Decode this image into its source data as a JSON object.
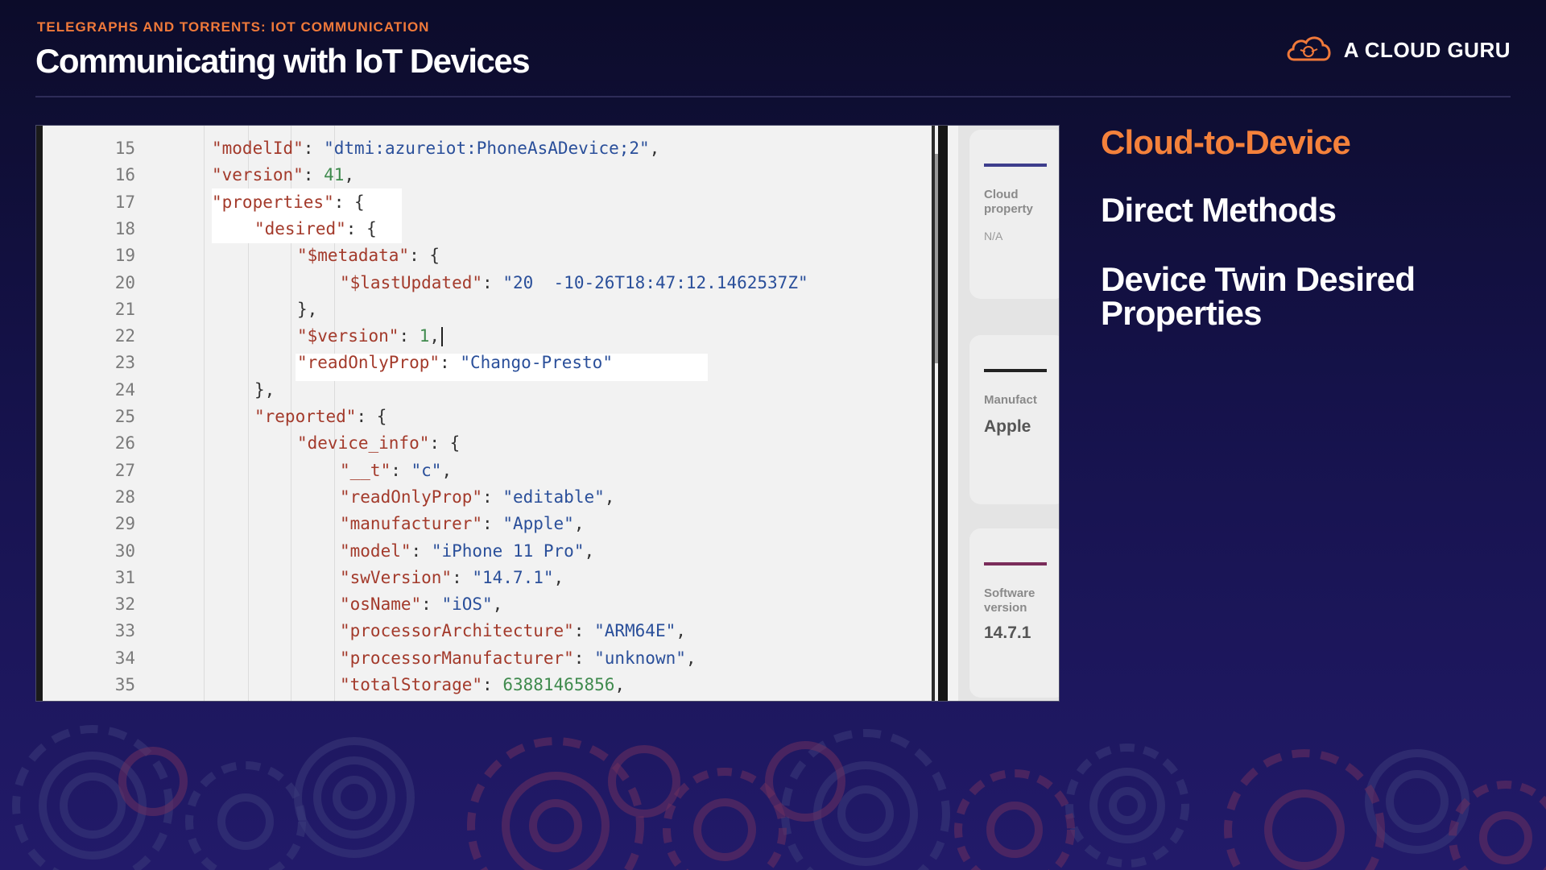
{
  "header": {
    "eyebrow": "TELEGRAPHS AND TORRENTS: IOT COMMUNICATION",
    "title": "Communicating with IoT Devices",
    "brand": "A CLOUD GURU",
    "brand_icon": "cloud-logo-icon"
  },
  "code": {
    "lines": [
      {
        "n": "15",
        "indent": 0,
        "key": "\"modelId\"",
        "sep": ": ",
        "val": "\"dtmi:azureiot:PhoneAsADevice;2\"",
        "vtype": "s",
        "tail": ","
      },
      {
        "n": "16",
        "indent": 0,
        "key": "\"version\"",
        "sep": ": ",
        "val": "41",
        "vtype": "n",
        "tail": ","
      },
      {
        "n": "17",
        "indent": 0,
        "key": "\"properties\"",
        "sep": ": ",
        "val": "",
        "vtype": "p",
        "tail": "{"
      },
      {
        "n": "18",
        "indent": 1,
        "key": "\"desired\"",
        "sep": ": ",
        "val": "",
        "vtype": "p",
        "tail": "{"
      },
      {
        "n": "19",
        "indent": 2,
        "key": "\"$metadata\"",
        "sep": ": ",
        "val": "",
        "vtype": "p",
        "tail": "{"
      },
      {
        "n": "20",
        "indent": 3,
        "key": "\"$lastUpdated\"",
        "sep": ": ",
        "val": "\"20  -10-26T18:47:12.1462537Z\"",
        "vtype": "s",
        "tail": ""
      },
      {
        "n": "21",
        "indent": 2,
        "key": "",
        "sep": "",
        "val": "",
        "vtype": "p",
        "tail": "},"
      },
      {
        "n": "22",
        "indent": 2,
        "key": "\"$version\"",
        "sep": ": ",
        "val": "1",
        "vtype": "n",
        "tail": ","
      },
      {
        "n": "23",
        "indent": 2,
        "key": "\"readOnlyProp\"",
        "sep": ": ",
        "val": "\"Chango-Presto\"",
        "vtype": "s",
        "tail": ""
      },
      {
        "n": "24",
        "indent": 1,
        "key": "",
        "sep": "",
        "val": "",
        "vtype": "p",
        "tail": "},"
      },
      {
        "n": "25",
        "indent": 1,
        "key": "\"reported\"",
        "sep": ": ",
        "val": "",
        "vtype": "p",
        "tail": "{"
      },
      {
        "n": "26",
        "indent": 2,
        "key": "\"device_info\"",
        "sep": ": ",
        "val": "",
        "vtype": "p",
        "tail": "{"
      },
      {
        "n": "27",
        "indent": 3,
        "key": "\"__t\"",
        "sep": ": ",
        "val": "\"c\"",
        "vtype": "s",
        "tail": ","
      },
      {
        "n": "28",
        "indent": 3,
        "key": "\"readOnlyProp\"",
        "sep": ": ",
        "val": "\"editable\"",
        "vtype": "s",
        "tail": ","
      },
      {
        "n": "29",
        "indent": 3,
        "key": "\"manufacturer\"",
        "sep": ": ",
        "val": "\"Apple\"",
        "vtype": "s",
        "tail": ","
      },
      {
        "n": "30",
        "indent": 3,
        "key": "\"model\"",
        "sep": ": ",
        "val": "\"iPhone 11 Pro\"",
        "vtype": "s",
        "tail": ","
      },
      {
        "n": "31",
        "indent": 3,
        "key": "\"swVersion\"",
        "sep": ": ",
        "val": "\"14.7.1\"",
        "vtype": "s",
        "tail": ","
      },
      {
        "n": "32",
        "indent": 3,
        "key": "\"osName\"",
        "sep": ": ",
        "val": "\"iOS\"",
        "vtype": "s",
        "tail": ","
      },
      {
        "n": "33",
        "indent": 3,
        "key": "\"processorArchitecture\"",
        "sep": ": ",
        "val": "\"ARM64E\"",
        "vtype": "s",
        "tail": ","
      },
      {
        "n": "34",
        "indent": 3,
        "key": "\"processorManufacturer\"",
        "sep": ": ",
        "val": "\"unknown\"",
        "vtype": "s",
        "tail": ","
      },
      {
        "n": "35",
        "indent": 3,
        "key": "\"totalStorage\"",
        "sep": ": ",
        "val": "63881465856",
        "vtype": "n",
        "tail": ","
      }
    ]
  },
  "side_cards": [
    {
      "label": "Cloud property",
      "value": "N/A",
      "bar_color": "#3d3d8c"
    },
    {
      "label": "Manufact",
      "value": "Apple",
      "bar_color": "#222222"
    },
    {
      "label": "Software version",
      "value": "14.7.1",
      "bar_color": "#7a2c5a"
    }
  ],
  "topics": [
    {
      "label": "Cloud-to-Device",
      "active": true
    },
    {
      "label": "Direct Methods",
      "active": false
    },
    {
      "label": "Device Twin Desired Properties",
      "active": false
    }
  ],
  "colors": {
    "accent": "#f4813b",
    "key": "#a33a2b",
    "string": "#2a4f9a",
    "number": "#3f8a4d"
  }
}
